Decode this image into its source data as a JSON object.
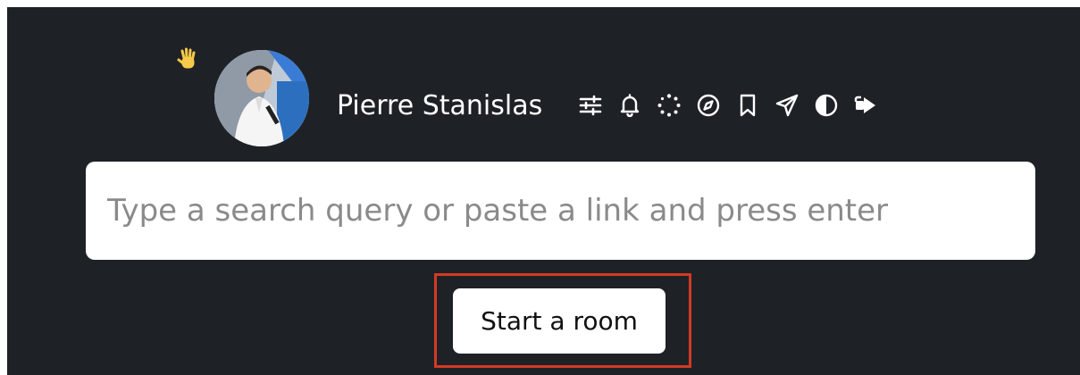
{
  "header": {
    "greeting_icon": "waving-hand-icon",
    "avatar_icon": "user-avatar",
    "username": "Pierre Stanislas",
    "toolbar_icons": [
      "sliders-icon",
      "bell-icon",
      "loading-dots-icon",
      "compass-icon",
      "bookmark-icon",
      "send-icon",
      "contrast-icon",
      "logout-icon"
    ]
  },
  "search": {
    "placeholder": "Type a search query or paste a link and press enter",
    "value": ""
  },
  "actions": {
    "start_room_label": "Start a room"
  },
  "colors": {
    "background": "#1e2227",
    "highlight": "#d23a24",
    "wave": "#f7c948"
  }
}
